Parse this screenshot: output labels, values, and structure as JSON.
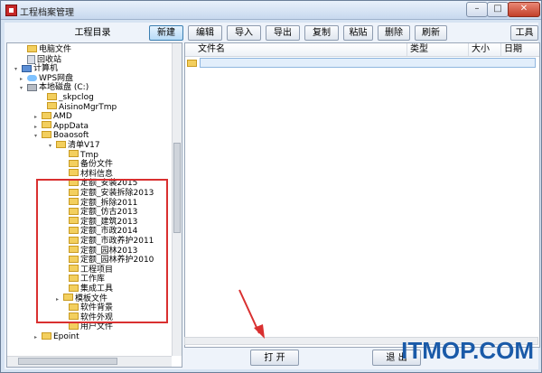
{
  "window": {
    "title": "工程档案管理",
    "controls": {
      "minimize": "–",
      "maximize": "□",
      "close": "✕"
    }
  },
  "tree_panel": {
    "header": "工程目录",
    "nodes": [
      {
        "label": "电脑文件",
        "icon": "folder-icon",
        "arrow": ""
      },
      {
        "label": "回收站",
        "icon": "recycle-bin-icon",
        "arrow": ""
      },
      {
        "label": "计算机",
        "icon": "computer-icon",
        "arrow": "▾"
      },
      {
        "label": "WPS网盘",
        "icon": "cloud-icon",
        "arrow": "▸"
      },
      {
        "label": "本地磁盘 (C:)",
        "icon": "disk-icon",
        "arrow": "▾"
      },
      {
        "label": "_skpclog",
        "icon": "folder-icon",
        "arrow": ""
      },
      {
        "label": "AisinoMgrTmp",
        "icon": "folder-icon",
        "arrow": ""
      },
      {
        "label": "AMD",
        "icon": "folder-icon",
        "arrow": "▸"
      },
      {
        "label": "AppData",
        "icon": "folder-icon",
        "arrow": "▸"
      },
      {
        "label": "Boaosoft",
        "icon": "folder-icon",
        "arrow": "▾"
      },
      {
        "label": "清单V17",
        "icon": "folder-icon",
        "arrow": "▾"
      },
      {
        "label": "Tmp",
        "icon": "folder-icon",
        "arrow": ""
      },
      {
        "label": "备份文件",
        "icon": "folder-icon",
        "arrow": ""
      },
      {
        "label": "材料信息",
        "icon": "folder-icon",
        "arrow": ""
      },
      {
        "label": "定额_安装2015",
        "icon": "folder-icon",
        "arrow": ""
      },
      {
        "label": "定额_安装拆除2013",
        "icon": "folder-icon",
        "arrow": ""
      },
      {
        "label": "定额_拆除2011",
        "icon": "folder-icon",
        "arrow": ""
      },
      {
        "label": "定额_仿古2013",
        "icon": "folder-icon",
        "arrow": ""
      },
      {
        "label": "定额_建筑2013",
        "icon": "folder-icon",
        "arrow": ""
      },
      {
        "label": "定额_市政2014",
        "icon": "folder-icon",
        "arrow": ""
      },
      {
        "label": "定额_市政养护2011",
        "icon": "folder-icon",
        "arrow": ""
      },
      {
        "label": "定额_园林2013",
        "icon": "folder-icon",
        "arrow": ""
      },
      {
        "label": "定额_园林养护2010",
        "icon": "folder-icon",
        "arrow": ""
      },
      {
        "label": "工程项目",
        "icon": "folder-icon",
        "arrow": ""
      },
      {
        "label": "工作库",
        "icon": "folder-icon",
        "arrow": ""
      },
      {
        "label": "集成工具",
        "icon": "folder-icon",
        "arrow": ""
      },
      {
        "label": "模板文件",
        "icon": "folder-icon",
        "arrow": "▸"
      },
      {
        "label": "软件背景",
        "icon": "folder-icon",
        "arrow": ""
      },
      {
        "label": "软件外观",
        "icon": "folder-icon",
        "arrow": ""
      },
      {
        "label": "用户文件",
        "icon": "folder-icon",
        "arrow": ""
      },
      {
        "label": "Epoint",
        "icon": "folder-icon",
        "arrow": "▸"
      }
    ]
  },
  "toolbar": {
    "buttons": [
      "新建",
      "编辑",
      "导入",
      "导出",
      "复制",
      "粘贴",
      "删除",
      "刷新"
    ],
    "tools": "工具"
  },
  "file_list": {
    "columns": [
      "文件名",
      "类型",
      "大小",
      "日期"
    ],
    "rows": [
      {
        "name": ""
      }
    ]
  },
  "bottom_buttons": {
    "open": "打 开",
    "exit": "退 出"
  },
  "watermark": "ITMOP.COM",
  "colors": {
    "highlight_box": "#d93030",
    "arrow": "#d93030",
    "watermark": "#1a5aa8"
  }
}
